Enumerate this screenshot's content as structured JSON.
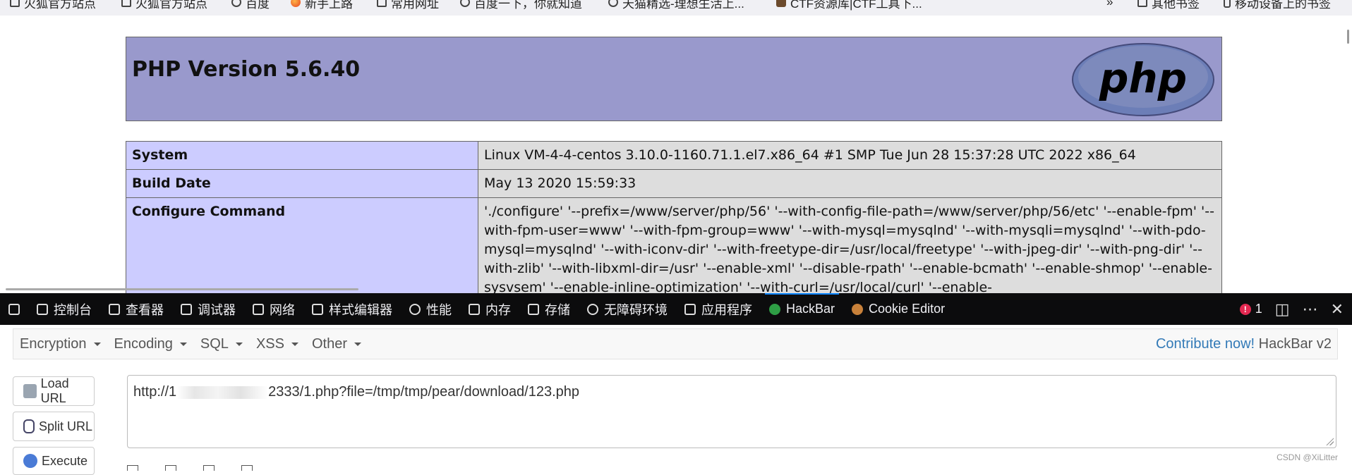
{
  "bookmarks": [
    {
      "label": "火狐官方站点",
      "icon": "folder-icon"
    },
    {
      "label": "火狐官方站点",
      "icon": "folder-icon"
    },
    {
      "label": "百度",
      "icon": "globe-icon"
    },
    {
      "label": "新手上路",
      "icon": "firefox-icon"
    },
    {
      "label": "常用网址",
      "icon": "folder-icon"
    },
    {
      "label": "百度一下，你就知道",
      "icon": "globe-icon"
    },
    {
      "label": "天猫精选-理想生活上...",
      "icon": "globe-icon"
    },
    {
      "label": "CTF资源库|CTF工具下...",
      "icon": "avatar-icon"
    }
  ],
  "bookmarks_right": {
    "overflow": "»",
    "other": "其他书签",
    "mobile": "移动设备上的书签"
  },
  "phpinfo": {
    "title": "PHP Version 5.6.40",
    "logo_text": "php",
    "rows": [
      {
        "key": "System",
        "value": "Linux VM-4-4-centos 3.10.0-1160.71.1.el7.x86_64 #1 SMP Tue Jun 28 15:37:28 UTC 2022 x86_64"
      },
      {
        "key": "Build Date",
        "value": "May 13 2020 15:59:33"
      },
      {
        "key": "Configure Command",
        "value": "'./configure' '--prefix=/www/server/php/56' '--with-config-file-path=/www/server/php/56/etc' '--enable-fpm' '--with-fpm-user=www' '--with-fpm-group=www' '--with-mysql=mysqlnd' '--with-mysqli=mysqlnd' '--with-pdo-mysql=mysqlnd' '--with-iconv-dir' '--with-freetype-dir=/usr/local/freetype' '--with-jpeg-dir' '--with-png-dir' '--with-zlib' '--with-libxml-dir=/usr' '--enable-xml' '--disable-rpath' '--enable-bcmath' '--enable-shmop' '--enable-sysvsem' '--enable-inline-optimization' '--with-curl=/usr/local/curl' '--enable-"
      }
    ]
  },
  "devtools": {
    "tabs": [
      {
        "label": "控制台",
        "icon": "console-icon"
      },
      {
        "label": "查看器",
        "icon": "inspector-icon"
      },
      {
        "label": "调试器",
        "icon": "debugger-icon"
      },
      {
        "label": "网络",
        "icon": "network-icon"
      },
      {
        "label": "样式编辑器",
        "icon": "style-editor-icon"
      },
      {
        "label": "性能",
        "icon": "performance-icon"
      },
      {
        "label": "内存",
        "icon": "memory-icon"
      },
      {
        "label": "存储",
        "icon": "storage-icon"
      },
      {
        "label": "无障碍环境",
        "icon": "accessibility-icon"
      },
      {
        "label": "应用程序",
        "icon": "application-icon"
      },
      {
        "label": "HackBar",
        "icon": "hackbar-icon",
        "active": true
      },
      {
        "label": "Cookie Editor",
        "icon": "cookie-icon"
      }
    ],
    "error_count": "1",
    "error_glyph": "!"
  },
  "hackbar": {
    "menu": [
      "Encryption",
      "Encoding",
      "SQL",
      "XSS",
      "Other"
    ],
    "contribute": "Contribute now!",
    "version": "HackBar v2",
    "buttons": {
      "load": "Load URL",
      "split": "Split URL",
      "execute": "Execute"
    },
    "url_prefix": "http://1",
    "url_suffix": "2333/1.php?file=/tmp/tmp/pear/download/123.php"
  },
  "watermark": "CSDN @XiLitter"
}
